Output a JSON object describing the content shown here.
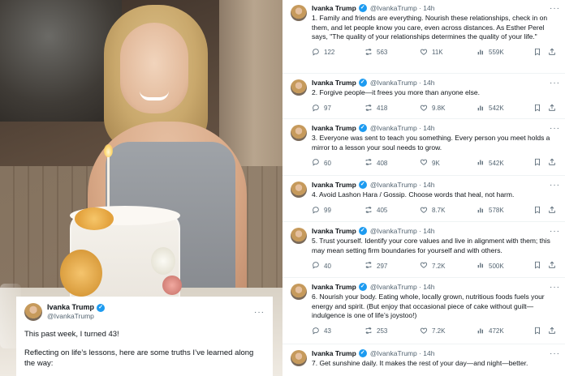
{
  "overlay_tweet": {
    "name": "Ivanka Trump",
    "handle": "@IvankaTrump",
    "paragraph1": "This past week, I turned 43!",
    "paragraph2": "Reflecting on life’s lessons, here are some truths I’ve learned along the way:",
    "more": "···"
  },
  "thread": {
    "tweets": [
      {
        "name": "Ivanka Trump",
        "handle": "@IvankaTrump · 14h",
        "text": "1. Family and friends are everything. Nourish these relationships, check in on them, and let people know you care, even across distances. As Esther Perel says, \"The quality of your relationships determines the quality of your life.\"",
        "replies": "122",
        "reposts": "563",
        "likes": "11K",
        "views": "559K"
      },
      {
        "name": "Ivanka Trump",
        "handle": "@IvankaTrump · 14h",
        "text": "2. Forgive people—it frees you more than anyone else.",
        "replies": "97",
        "reposts": "418",
        "likes": "9.8K",
        "views": "542K"
      },
      {
        "name": "Ivanka Trump",
        "handle": "@IvankaTrump · 14h",
        "text": "3. Everyone was sent to teach you something. Every person you meet holds a mirror to a lesson your soul needs to grow.",
        "replies": "60",
        "reposts": "408",
        "likes": "9K",
        "views": "542K"
      },
      {
        "name": "Ivanka Trump",
        "handle": "@IvankaTrump · 14h",
        "text": "4. Avoid Lashon Hara / Gossip. Choose words that heal, not harm.",
        "replies": "99",
        "reposts": "405",
        "likes": "8.7K",
        "views": "578K"
      },
      {
        "name": "Ivanka Trump",
        "handle": "@IvankaTrump · 14h",
        "text": "5. Trust yourself. Identify your core values and live in alignment with them; this may mean setting firm boundaries for yourself and with others.",
        "replies": "40",
        "reposts": "297",
        "likes": "7.2K",
        "views": "500K"
      },
      {
        "name": "Ivanka Trump",
        "handle": "@IvankaTrump · 14h",
        "text": "6. Nourish your body. Eating whole, locally grown, nutritious foods fuels your energy and spirit. (But enjoy that occasional piece of cake without guilt—indulgence is one of life’s joystoo!)",
        "replies": "43",
        "reposts": "253",
        "likes": "7.2K",
        "views": "472K"
      },
      {
        "name": "Ivanka Trump",
        "handle": "@IvankaTrump · 14h",
        "text": "7. Get sunshine daily. It makes the rest of your day—and night—better."
      }
    ],
    "more": "···"
  },
  "icons": [
    "reply-icon",
    "repost-icon",
    "like-icon",
    "views-icon",
    "bookmark-icon",
    "share-icon",
    "verified-icon",
    "more-icon"
  ],
  "colors": {
    "verified": "#1d9bf0",
    "secondary_text": "#536471",
    "text": "#0f1419"
  }
}
